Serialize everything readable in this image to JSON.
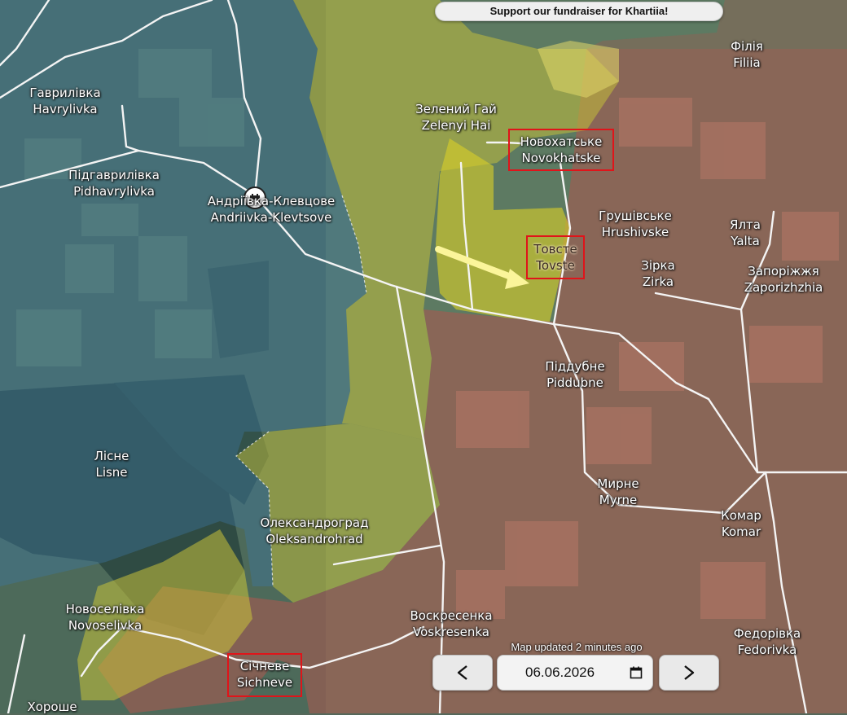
{
  "banner": {
    "text": "Support our fundraiser for Khartiia!"
  },
  "colors": {
    "russian_controlled": "#b05a4f",
    "contested": "#c8c23a",
    "ukrainian_controlled": "#3d7aa8",
    "advance_arrow": "#fbf59a",
    "highlight_box": "#e0141a"
  },
  "places": [
    {
      "id": "havrylivka",
      "uk": "Гаврилівка",
      "en": "Havrylivka"
    },
    {
      "id": "pidhavrylivka",
      "uk": "Підгаврилівка",
      "en": "Pidhavrylivka"
    },
    {
      "id": "andriivka",
      "uk": "Андріївка-Клевцове",
      "en": "Andriivka-Klevtsove"
    },
    {
      "id": "zelenyi",
      "uk": "Зелений Гай",
      "en": "Zelenyi Hai"
    },
    {
      "id": "novokhatske",
      "uk": "Новохатське",
      "en": "Novokhatske"
    },
    {
      "id": "filiia",
      "uk": "Філія",
      "en": "Filiia"
    },
    {
      "id": "hrushivske",
      "uk": "Грушівське",
      "en": "Hrushivske"
    },
    {
      "id": "yalta",
      "uk": "Ялта",
      "en": "Yalta"
    },
    {
      "id": "tovste",
      "uk": "Товсте",
      "en": "Tovste"
    },
    {
      "id": "zirka",
      "uk": "Зірка",
      "en": "Zirka"
    },
    {
      "id": "zaporizhzhia",
      "uk": "Запоріжжя",
      "en": "Zaporizhzhia"
    },
    {
      "id": "piddubne",
      "uk": "Піддубне",
      "en": "Piddubne"
    },
    {
      "id": "lisne",
      "uk": "Лісне",
      "en": "Lisne"
    },
    {
      "id": "myrne",
      "uk": "Мирне",
      "en": "Myrne"
    },
    {
      "id": "komar",
      "uk": "Комар",
      "en": "Komar"
    },
    {
      "id": "oleksandrohrad",
      "uk": "Олександроград",
      "en": "Oleksandrohrad"
    },
    {
      "id": "novoselivka",
      "uk": "Новоселівка",
      "en": "Novoselivka"
    },
    {
      "id": "voskresenka",
      "uk": "Воскресенка",
      "en": "Voskresenka"
    },
    {
      "id": "fedorivka",
      "uk": "Федорівка",
      "en": "Fedorivka"
    },
    {
      "id": "sichneve",
      "uk": "Січневе",
      "en": "Sichneve"
    },
    {
      "id": "khoroshe",
      "uk": "Хороше",
      "en": ""
    }
  ],
  "footer": {
    "updated": "Map updated 2 minutes ago",
    "date": "06.06.2026",
    "prev_icon": "arrow-left-icon",
    "next_icon": "arrow-right-icon",
    "calendar_icon": "calendar-icon"
  },
  "marker_icon": "fortification-icon"
}
